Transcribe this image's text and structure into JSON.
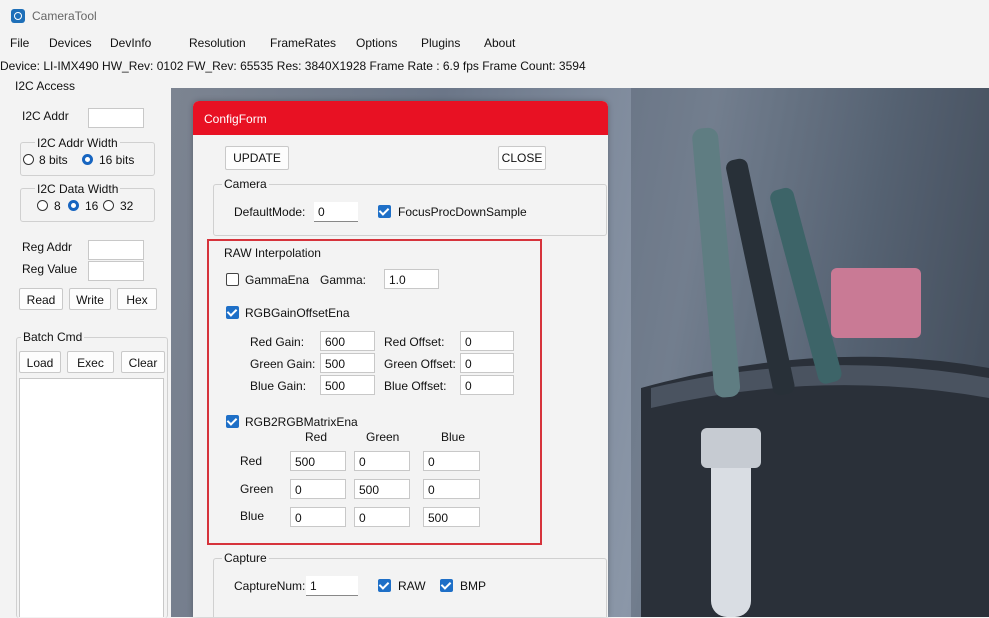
{
  "app": {
    "title": "CameraTool"
  },
  "menu": [
    "File",
    "Devices",
    "DevInfo",
    "Resolution",
    "FrameRates",
    "Options",
    "Plugins",
    "About"
  ],
  "info": {
    "text": "Device:  LI-IMX490  HW_Rev:  0102  FW_Rev:  65535  Res:  3840X1928  Frame Rate :  6.9 fps  Frame Count: 3594"
  },
  "i2c": {
    "group_title": "I2C Access",
    "addr_label": "I2C Addr",
    "addr_value": "",
    "addr_width": {
      "title": "I2C Addr Width",
      "opt1": "8 bits",
      "opt2": "16 bits",
      "selected": "16 bits"
    },
    "data_width": {
      "title": "I2C Data Width",
      "opt1": "8",
      "opt2": "16",
      "opt3": "32",
      "selected": "16"
    },
    "reg_addr_label": "Reg Addr",
    "reg_value_label": "Reg Value",
    "read": "Read",
    "write": "Write",
    "hex": "Hex"
  },
  "batch": {
    "title": "Batch Cmd",
    "load": "Load",
    "exec": "Exec",
    "clear": "Clear"
  },
  "config": {
    "title": "ConfigForm",
    "update": "UPDATE",
    "close": "CLOSE",
    "camera": {
      "title": "Camera",
      "default_mode_label": "DefaultMode:",
      "default_mode_value": "0",
      "focus_label": "FocusProcDownSample",
      "focus_checked": true
    },
    "raw": {
      "title": "RAW Interpolation",
      "gamma_ena_label": "GammaEna",
      "gamma_ena_checked": false,
      "gamma_label": "Gamma:",
      "gamma_value": "1.0",
      "rgb_gain_label": "RGBGainOffsetEna",
      "rgb_gain_checked": true,
      "red_gain_label": "Red Gain:",
      "red_gain": "600",
      "green_gain_label": "Green Gain:",
      "green_gain": "500",
      "blue_gain_label": "Blue Gain:",
      "blue_gain": "500",
      "red_offset_label": "Red Offset:",
      "red_offset": "0",
      "green_offset_label": "Green Offset:",
      "green_offset": "0",
      "blue_offset_label": "Blue Offset:",
      "blue_offset": "0",
      "matrix_label": "RGB2RGBMatrixEna",
      "matrix_checked": true,
      "col_red": "Red",
      "col_green": "Green",
      "col_blue": "Blue",
      "row_red": "Red",
      "row_green": "Green",
      "row_blue": "Blue",
      "matrix": [
        [
          "500",
          "0",
          "0"
        ],
        [
          "0",
          "500",
          "0"
        ],
        [
          "0",
          "0",
          "500"
        ]
      ]
    },
    "capture": {
      "title": "Capture",
      "num_label": "CaptureNum:",
      "num_value": "1",
      "raw_label": "RAW",
      "raw_checked": true,
      "bmp_label": "BMP",
      "bmp_checked": true
    }
  },
  "colors": {
    "accent": "#e81123",
    "highlight": "#d6333b",
    "check": "#1e6fc7"
  }
}
